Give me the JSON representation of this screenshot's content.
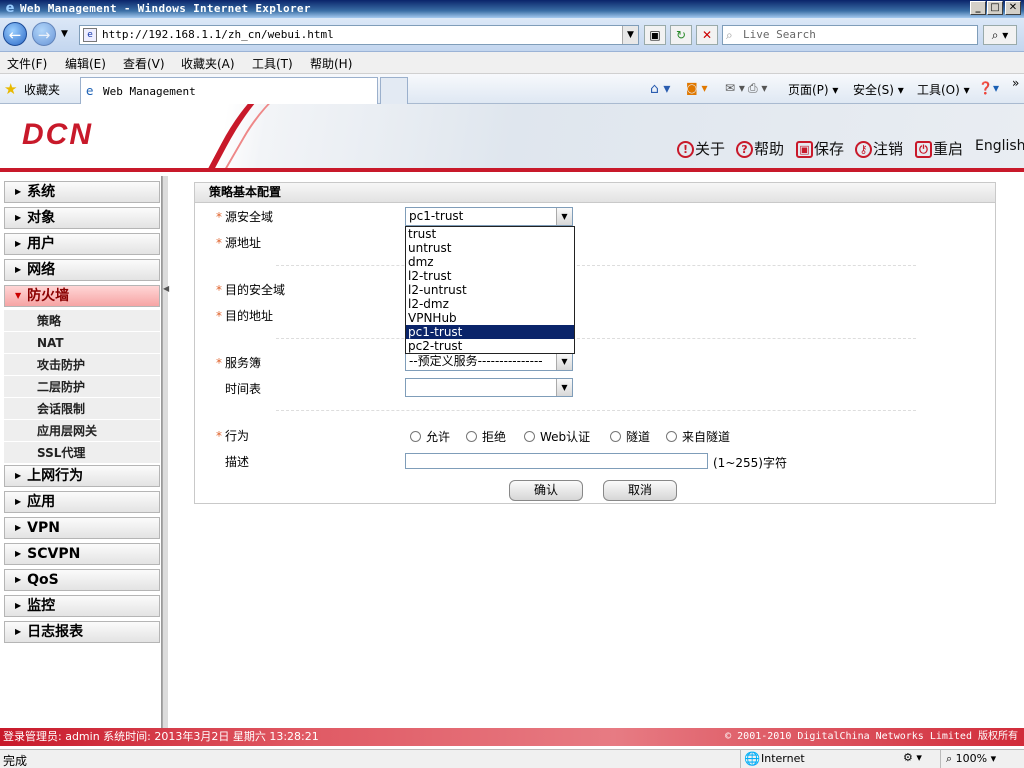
{
  "window": {
    "title": "Web Management - Windows Internet Explorer"
  },
  "browser": {
    "url": "http://192.168.1.1/zh_cn/webui.html",
    "search_placeholder": "Live Search",
    "menus": [
      "文件(F)",
      "编辑(E)",
      "查看(V)",
      "收藏夹(A)",
      "工具(T)",
      "帮助(H)"
    ],
    "favorites_label": "收藏夹",
    "tab_title": "Web Management",
    "commands": {
      "page": "页面(P)",
      "safety": "安全(S)",
      "tools": "工具(O)"
    },
    "status_text": "完成",
    "zone": "Internet",
    "zoom": "100%"
  },
  "app": {
    "logo": "DCN",
    "header_links": {
      "about": "关于",
      "help": "帮助",
      "save": "保存",
      "logout": "注销",
      "restart": "重启",
      "language": "English"
    },
    "sidebar": {
      "items": [
        "系统",
        "对象",
        "用户",
        "网络",
        "防火墙"
      ],
      "subitems": [
        "策略",
        "NAT",
        "攻击防护",
        "二层防护",
        "会话限制",
        "应用层网关",
        "SSL代理"
      ],
      "items_after": [
        "上网行为",
        "应用",
        "VPN",
        "SCVPN",
        "QoS",
        "监控",
        "日志报表"
      ]
    },
    "form": {
      "title": "策略基本配置",
      "labels": {
        "src_zone": "源安全域",
        "src_addr": "源地址",
        "dst_zone": "目的安全域",
        "dst_addr": "目的地址",
        "service": "服务簿",
        "schedule": "时间表",
        "action": "行为",
        "description": "描述"
      },
      "src_zone_value": "pc1-trust",
      "zone_options": [
        "trust",
        "untrust",
        "dmz",
        "l2-trust",
        "l2-untrust",
        "l2-dmz",
        "VPNHub",
        "pc1-trust",
        "pc2-trust"
      ],
      "service_value": "--预定义服务---------------",
      "schedule_value": "",
      "actions": [
        "允许",
        "拒绝",
        "Web认证",
        "隧道",
        "来自隧道"
      ],
      "description_hint": "(1~255)字符",
      "buttons": {
        "ok": "确认",
        "cancel": "取消"
      }
    },
    "footer": {
      "login_info": "登录管理员: admin 系统时间: 2013年3月2日 星期六 13:28:21",
      "copyright": "© 2001-2010 DigitalChina Networks Limited 版权所有"
    }
  }
}
